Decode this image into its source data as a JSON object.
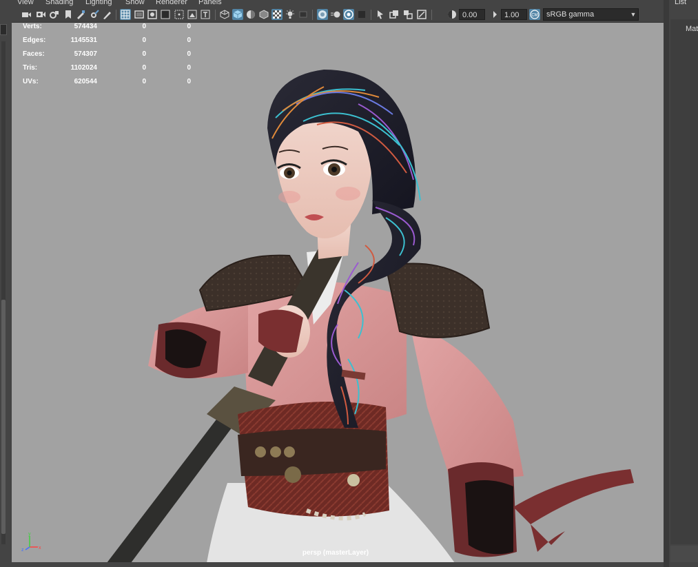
{
  "menu": {
    "view": "View",
    "shading": "Shading",
    "lighting": "Lighting",
    "show": "Show",
    "renderer": "Renderer",
    "panels": "Panels"
  },
  "toolbar": {
    "exposure": "0.00",
    "gamma": "1.00",
    "color_space": "sRGB gamma",
    "accent": "#5285a6"
  },
  "hud": {
    "rows": [
      {
        "label": "Verts:",
        "v1": "574434",
        "v2": "0",
        "v3": "0"
      },
      {
        "label": "Edges:",
        "v1": "1145531",
        "v2": "0",
        "v3": "0"
      },
      {
        "label": "Faces:",
        "v1": "574307",
        "v2": "0",
        "v3": "0"
      },
      {
        "label": "Tris:",
        "v1": "1102024",
        "v2": "0",
        "v3": "0"
      },
      {
        "label": "UVs:",
        "v1": "620544",
        "v2": "0",
        "v3": "0"
      }
    ]
  },
  "viewport": {
    "camera_label": "persp (masterLayer)",
    "background": "#a2a2a2",
    "axis": {
      "x": "x",
      "y": "y",
      "z": "z"
    }
  },
  "right_panel": {
    "tab": "List",
    "item": "Mat"
  }
}
